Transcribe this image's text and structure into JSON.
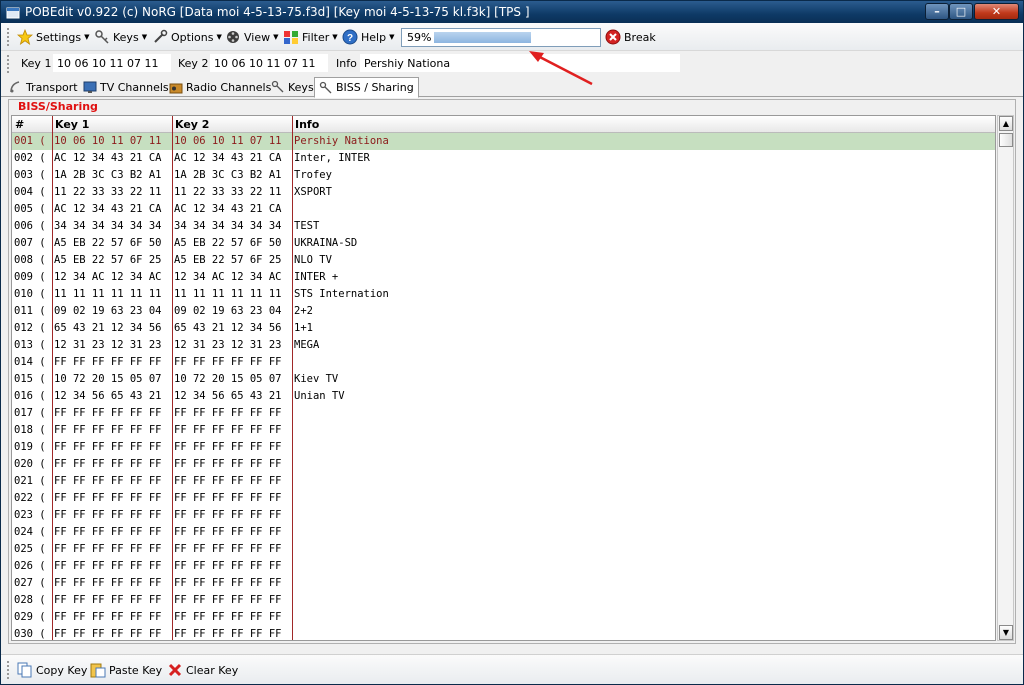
{
  "window": {
    "title": "POBEdit v0.922 (c) NoRG      [Data moi 4-5-13-75.f3d] [Key moi 4-5-13-75 kl.f3k] [TPS ]",
    "min_glyph": "–",
    "max_glyph": "□",
    "close_glyph": "✕"
  },
  "toolbar": {
    "settings": "Settings",
    "keys": "Keys",
    "options": "Options",
    "view": "View",
    "filter": "Filter",
    "help": "Help",
    "progress_text": "59%",
    "progress_value": 0.59,
    "break": "Break"
  },
  "keyrow": {
    "key1_label": "Key 1",
    "key1_value": "10 06 10 11 07 11",
    "key2_label": "Key 2",
    "key2_value": "10 06 10 11 07 11",
    "info_label": "Info",
    "info_value": "Pershiy Nationa"
  },
  "tabs": {
    "transport": "Transport",
    "tv": "TV Channels",
    "radio": "Radio Channels",
    "keys": "Keys",
    "biss": "BISS / Sharing"
  },
  "panel": {
    "title": "BISS/Sharing",
    "headers": {
      "num": "#",
      "key1": "Key 1",
      "key2": "Key 2",
      "info": "Info"
    },
    "rows": [
      {
        "num": "001 (",
        "k1": "10 06 10 11 07 11",
        "k2": "10 06 10 11 07 11",
        "info": "Pershiy Nationa"
      },
      {
        "num": "002 (",
        "k1": "AC 12 34 43 21 CA",
        "k2": "AC 12 34 43 21 CA",
        "info": "Inter, INTER"
      },
      {
        "num": "003 (",
        "k1": "1A 2B 3C C3 B2 A1",
        "k2": "1A 2B 3C C3 B2 A1",
        "info": "Trofey"
      },
      {
        "num": "004 (",
        "k1": "11 22 33 33 22 11",
        "k2": "11 22 33 33 22 11",
        "info": "XSPORT"
      },
      {
        "num": "005 (",
        "k1": "AC 12 34 43 21 CA",
        "k2": "AC 12 34 43 21 CA",
        "info": ""
      },
      {
        "num": "006 (",
        "k1": "34 34 34 34 34 34",
        "k2": "34 34 34 34 34 34",
        "info": "TEST"
      },
      {
        "num": "007 (",
        "k1": "A5 EB 22 57 6F 50",
        "k2": "A5 EB 22 57 6F 50",
        "info": "UKRAINA-SD"
      },
      {
        "num": "008 (",
        "k1": "A5 EB 22 57 6F 25",
        "k2": "A5 EB 22 57 6F 25",
        "info": "NLO TV"
      },
      {
        "num": "009 (",
        "k1": "12 34 AC 12 34 AC",
        "k2": "12 34 AC 12 34 AC",
        "info": "INTER +"
      },
      {
        "num": "010 (",
        "k1": "11 11 11 11 11 11",
        "k2": "11 11 11 11 11 11",
        "info": "STS Internation"
      },
      {
        "num": "011 (",
        "k1": "09 02 19 63 23 04",
        "k2": "09 02 19 63 23 04",
        "info": "2+2"
      },
      {
        "num": "012 (",
        "k1": "65 43 21 12 34 56",
        "k2": "65 43 21 12 34 56",
        "info": "1+1"
      },
      {
        "num": "013 (",
        "k1": "12 31 23 12 31 23",
        "k2": "12 31 23 12 31 23",
        "info": "MEGA"
      },
      {
        "num": "014 (",
        "k1": "FF FF FF FF FF FF",
        "k2": "FF FF FF FF FF FF",
        "info": ""
      },
      {
        "num": "015 (",
        "k1": "10 72 20 15 05 07",
        "k2": "10 72 20 15 05 07",
        "info": "Kiev TV"
      },
      {
        "num": "016 (",
        "k1": "12 34 56 65 43 21",
        "k2": "12 34 56 65 43 21",
        "info": "Unian TV"
      },
      {
        "num": "017 (",
        "k1": "FF FF FF FF FF FF",
        "k2": "FF FF FF FF FF FF",
        "info": ""
      },
      {
        "num": "018 (",
        "k1": "FF FF FF FF FF FF",
        "k2": "FF FF FF FF FF FF",
        "info": ""
      },
      {
        "num": "019 (",
        "k1": "FF FF FF FF FF FF",
        "k2": "FF FF FF FF FF FF",
        "info": ""
      },
      {
        "num": "020 (",
        "k1": "FF FF FF FF FF FF",
        "k2": "FF FF FF FF FF FF",
        "info": ""
      },
      {
        "num": "021 (",
        "k1": "FF FF FF FF FF FF",
        "k2": "FF FF FF FF FF FF",
        "info": ""
      },
      {
        "num": "022 (",
        "k1": "FF FF FF FF FF FF",
        "k2": "FF FF FF FF FF FF",
        "info": ""
      },
      {
        "num": "023 (",
        "k1": "FF FF FF FF FF FF",
        "k2": "FF FF FF FF FF FF",
        "info": ""
      },
      {
        "num": "024 (",
        "k1": "FF FF FF FF FF FF",
        "k2": "FF FF FF FF FF FF",
        "info": ""
      },
      {
        "num": "025 (",
        "k1": "FF FF FF FF FF FF",
        "k2": "FF FF FF FF FF FF",
        "info": ""
      },
      {
        "num": "026 (",
        "k1": "FF FF FF FF FF FF",
        "k2": "FF FF FF FF FF FF",
        "info": ""
      },
      {
        "num": "027 (",
        "k1": "FF FF FF FF FF FF",
        "k2": "FF FF FF FF FF FF",
        "info": ""
      },
      {
        "num": "028 (",
        "k1": "FF FF FF FF FF FF",
        "k2": "FF FF FF FF FF FF",
        "info": ""
      },
      {
        "num": "029 (",
        "k1": "FF FF FF FF FF FF",
        "k2": "FF FF FF FF FF FF",
        "info": ""
      },
      {
        "num": "030 (",
        "k1": "FF FF FF FF FF FF",
        "k2": "FF FF FF FF FF FF",
        "info": ""
      }
    ]
  },
  "bottombar": {
    "copy": "Copy Key",
    "paste": "Paste Key",
    "clear": "Clear Key"
  },
  "icons": {
    "settings": "star-icon",
    "keys": "keys-icon",
    "options": "wrench-icon",
    "view": "film-icon",
    "filter": "filter-icon",
    "help": "help-icon",
    "break": "stop-icon"
  },
  "colors": {
    "accent": "#e01010",
    "selected_row": "#c6dfc0",
    "column_line": "#a02828",
    "annotation_arrow": "#e02020"
  }
}
